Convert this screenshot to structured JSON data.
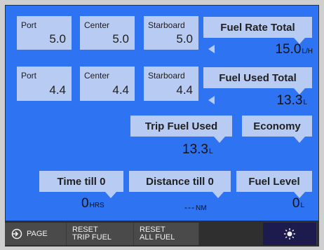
{
  "tanks_rate": [
    {
      "label": "Port",
      "value": "5.0"
    },
    {
      "label": "Center",
      "value": "5.0"
    },
    {
      "label": "Starboard",
      "value": "5.0"
    }
  ],
  "tanks_used": [
    {
      "label": "Port",
      "value": "4.4"
    },
    {
      "label": "Center",
      "value": "4.4"
    },
    {
      "label": "Starboard",
      "value": "4.4"
    }
  ],
  "fuel_rate_total": {
    "label": "Fuel Rate Total",
    "value": "15.0",
    "unit": "L/H"
  },
  "fuel_used_total": {
    "label": "Fuel Used Total",
    "value": "13.3",
    "unit": "L"
  },
  "trip_fuel_used": {
    "label": "Trip Fuel Used",
    "value": "13.3",
    "unit": "L"
  },
  "economy": {
    "label": "Economy"
  },
  "time_till_0": {
    "label": "Time till 0",
    "value": "0",
    "unit": "HRS"
  },
  "distance_till_0": {
    "label": "Distance till 0",
    "value": "---",
    "unit": "NM"
  },
  "fuel_level": {
    "label": "Fuel Level",
    "value": "0",
    "unit": "L"
  },
  "softkeys": {
    "page": "PAGE",
    "reset_trip_1": "RESET",
    "reset_trip_2": "TRIP FUEL",
    "reset_all_1": "RESET",
    "reset_all_2": "ALL FUEL"
  },
  "colors": {
    "screen": "#2d73f2",
    "panel": "#b8cbf2",
    "bar": "#2f2f2f"
  },
  "icons": [
    "page-icon",
    "brightness-icon",
    "left-arrow-icon"
  ]
}
